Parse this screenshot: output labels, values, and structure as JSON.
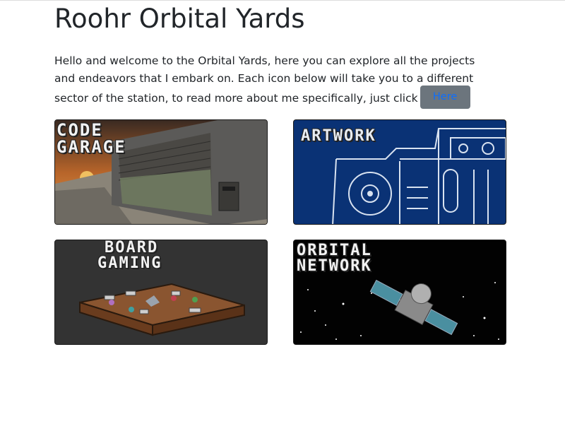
{
  "page": {
    "title": "Roohr Orbital Yards",
    "intro_lines": [
      "Hello and welcome to the Orbital Yards, here you can explore all the projects",
      "and endeavors that I embark on. Each icon below will take you to a different",
      "sector of the station, to read more about me specifically, just click"
    ],
    "here_button": "Here"
  },
  "tiles": [
    {
      "label_line1": "CODE",
      "label_line2": "GARAGE"
    },
    {
      "label_line1": "ARTWORK"
    },
    {
      "label_line1": "BOARD",
      "label_line2": "GAMING"
    },
    {
      "label_line1": "ORBITAL",
      "label_line2": "NETWORK"
    }
  ],
  "colors": {
    "button_bg": "#6c757d",
    "button_text": "#0d6efd",
    "artwork_blue": "#0a3275"
  }
}
